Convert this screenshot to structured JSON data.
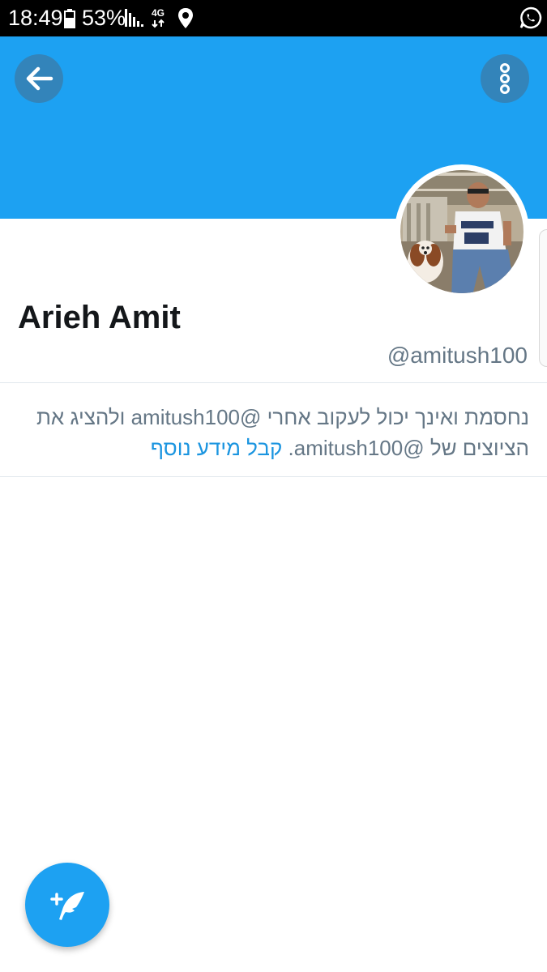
{
  "status_bar": {
    "time": "18:49",
    "battery_percent": "53%",
    "network_type": "4G",
    "icons": [
      "battery-icon",
      "signal-icon",
      "network-icon",
      "location-icon",
      "whatsapp-icon"
    ]
  },
  "header": {
    "banner_color": "#1da1f2",
    "back_icon": "arrow-left-icon",
    "more_icon": "more-vertical-icon"
  },
  "profile": {
    "name": "Arieh Amit",
    "handle": "@amitush100"
  },
  "blocked_notice": {
    "message": "נחסמת ואינך יכול לעקוב אחרי @amitush100 ולהציג את הציוצים של @amitush100. ",
    "link_text": "קבל מידע נוסף",
    "link_color": "#1b95e0"
  },
  "compose": {
    "icon": "compose-tweet-icon"
  }
}
